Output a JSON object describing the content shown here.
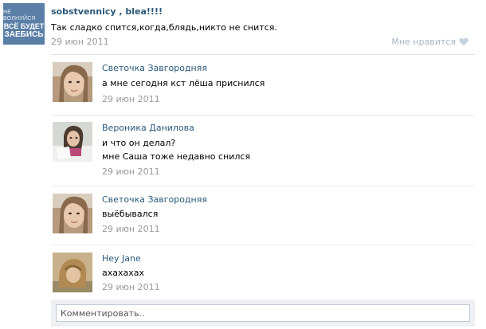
{
  "post": {
    "avatar_lines": [
      "Не волнуйся",
      "Всё будет",
      "Заебись"
    ],
    "author": "sobstvennicy , blea!!!!",
    "text": "Так сладко спится,когда,блядь,никто не снится.",
    "date": "29 июн 2011",
    "like_label": "Мне нравится",
    "like_icon": "heart-icon"
  },
  "comments": [
    {
      "name": "Светочка Завгородняя",
      "lines": [
        "а мне сегодня кст лёша приснился"
      ],
      "date": "29 июн 2011"
    },
    {
      "name": "Вероника Данилова",
      "lines": [
        "и что он делал?",
        "мне Саша тоже недавно снился"
      ],
      "date": "29 июн 2011"
    },
    {
      "name": "Светочка Завгородняя",
      "lines": [
        "выёбывался"
      ],
      "date": "29 июн 2011"
    },
    {
      "name": "Hey Jane",
      "lines": [
        "ахахахах"
      ],
      "date": "29 июн 2011"
    }
  ],
  "comment_box": {
    "placeholder": "Комментировать.."
  },
  "colors": {
    "link": "#2b587a",
    "date": "#999999",
    "like": "#a7b6c6"
  }
}
